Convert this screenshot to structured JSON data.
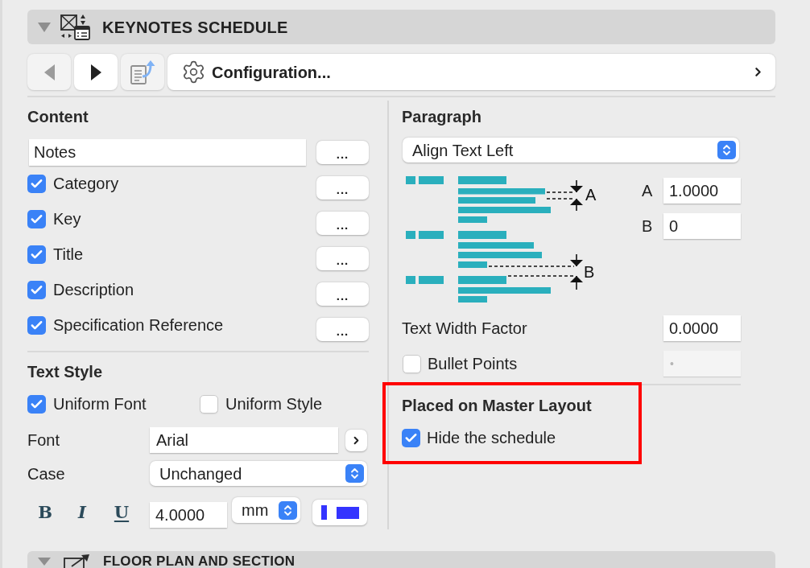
{
  "panel": {
    "title": "KEYNOTES SCHEDULE",
    "expanded": true
  },
  "toolbar": {
    "buttons": [
      {
        "kind": "back",
        "disabled": true
      },
      {
        "kind": "forward",
        "disabled": false
      },
      {
        "kind": "export",
        "disabled": true
      }
    ],
    "configuration": "Configuration..."
  },
  "content": {
    "heading": "Content",
    "name_field": {
      "value": "Notes",
      "more": "..."
    },
    "items": [
      {
        "label": "Category",
        "checked": true,
        "more": "..."
      },
      {
        "label": "Key",
        "checked": true,
        "more": "..."
      },
      {
        "label": "Title",
        "checked": true,
        "more": "..."
      },
      {
        "label": "Description",
        "checked": true,
        "more": "..."
      },
      {
        "label": "Specification Reference",
        "checked": true,
        "more": "..."
      }
    ]
  },
  "text_style": {
    "heading": "Text Style",
    "options": [
      {
        "label": "Uniform Font",
        "checked": true
      },
      {
        "label": "Uniform Style",
        "checked": false
      }
    ],
    "font": {
      "label": "Font",
      "value": "Arial"
    },
    "case": {
      "label": "Case",
      "value": "Unchanged"
    },
    "format_buttons": [
      {
        "kind": "bold",
        "glyph": "B"
      },
      {
        "kind": "italic",
        "glyph": "I"
      },
      {
        "kind": "underline",
        "glyph": "U"
      }
    ],
    "size": "4.0000",
    "unit": "mm",
    "pen": {
      "color": "#3434ff"
    }
  },
  "paragraph": {
    "heading": "Paragraph",
    "alignment": "Align Text Left",
    "diagram_labels": [
      "A",
      "B"
    ],
    "spacing": [
      {
        "label": "A",
        "value": "1.0000"
      },
      {
        "label": "B",
        "value": "0"
      }
    ],
    "width_factor": {
      "label": "Text Width Factor",
      "value": "0.0000"
    },
    "bullets": {
      "label": "Bullet Points",
      "checked": false,
      "symbol": "•",
      "symbol_disabled": true
    }
  },
  "master_layout": {
    "heading": "Placed on Master Layout",
    "highlighted": true,
    "hide": {
      "label": "Hide the schedule",
      "checked": true
    }
  },
  "next_panel": {
    "title": "FLOOR PLAN AND SECTION",
    "expanded": true
  }
}
